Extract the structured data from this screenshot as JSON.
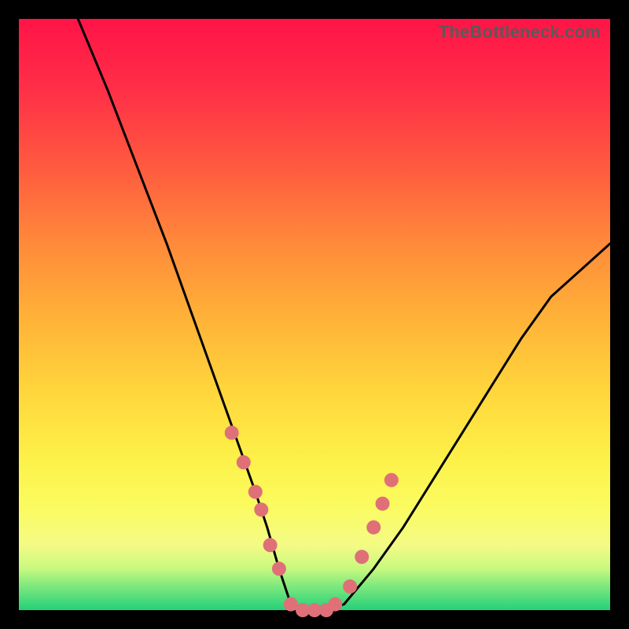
{
  "watermark": "TheBottleneck.com",
  "chart_data": {
    "type": "line",
    "title": "",
    "xlabel": "",
    "ylabel": "",
    "xlim": [
      0,
      100
    ],
    "ylim": [
      0,
      100
    ],
    "grid": false,
    "series": [
      {
        "name": "bottleneck-curve",
        "x": [
          10,
          15,
          20,
          25,
          30,
          35,
          40,
          42,
          44,
          46,
          48,
          50,
          52,
          55,
          60,
          65,
          70,
          75,
          80,
          85,
          90,
          100
        ],
        "values": [
          100,
          88,
          75,
          62,
          48,
          34,
          20,
          14,
          7,
          1,
          0,
          0,
          0,
          1,
          7,
          14,
          22,
          30,
          38,
          46,
          53,
          62
        ]
      }
    ],
    "markers": {
      "name": "highlighted-points",
      "color": "#e07078",
      "x": [
        36,
        38,
        40,
        41,
        42.5,
        44,
        46,
        48,
        50,
        52,
        53.5,
        56,
        58,
        60,
        61.5,
        63
      ],
      "values": [
        30,
        25,
        20,
        17,
        11,
        7,
        1,
        0,
        0,
        0,
        1,
        4,
        9,
        14,
        18,
        22
      ]
    },
    "floor_band": {
      "name": "optimal-band",
      "y_range": [
        0,
        2
      ],
      "color": "#25d07a"
    }
  }
}
